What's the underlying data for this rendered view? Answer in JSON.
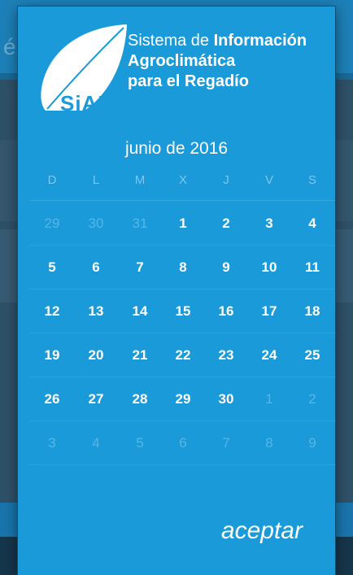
{
  "background": {
    "partial_text": "é"
  },
  "header": {
    "logo_text": "SiAR",
    "title_line1_regular": "Sistema de ",
    "title_line1_bold": "Información",
    "title_line2": "Agroclimática",
    "title_line3": "para el Regadío"
  },
  "calendar": {
    "month_label": "junio de 2016",
    "weekdays": [
      "D",
      "L",
      "M",
      "X",
      "J",
      "V",
      "S"
    ],
    "weeks": [
      [
        {
          "d": "29",
          "dim": true
        },
        {
          "d": "30",
          "dim": true
        },
        {
          "d": "31",
          "dim": true
        },
        {
          "d": "1",
          "dim": false
        },
        {
          "d": "2",
          "dim": false
        },
        {
          "d": "3",
          "dim": false
        },
        {
          "d": "4",
          "dim": false
        }
      ],
      [
        {
          "d": "5",
          "dim": false
        },
        {
          "d": "6",
          "dim": false
        },
        {
          "d": "7",
          "dim": false
        },
        {
          "d": "8",
          "dim": false
        },
        {
          "d": "9",
          "dim": false
        },
        {
          "d": "10",
          "dim": false
        },
        {
          "d": "11",
          "dim": false
        }
      ],
      [
        {
          "d": "12",
          "dim": false
        },
        {
          "d": "13",
          "dim": false
        },
        {
          "d": "14",
          "dim": false
        },
        {
          "d": "15",
          "dim": false
        },
        {
          "d": "16",
          "dim": false
        },
        {
          "d": "17",
          "dim": false
        },
        {
          "d": "18",
          "dim": false
        }
      ],
      [
        {
          "d": "19",
          "dim": false
        },
        {
          "d": "20",
          "dim": false
        },
        {
          "d": "21",
          "dim": false
        },
        {
          "d": "22",
          "dim": false
        },
        {
          "d": "23",
          "dim": false
        },
        {
          "d": "24",
          "dim": false
        },
        {
          "d": "25",
          "dim": false
        }
      ],
      [
        {
          "d": "26",
          "dim": false
        },
        {
          "d": "27",
          "dim": false
        },
        {
          "d": "28",
          "dim": false
        },
        {
          "d": "29",
          "dim": false
        },
        {
          "d": "30",
          "dim": false
        },
        {
          "d": "1",
          "dim": true
        },
        {
          "d": "2",
          "dim": true
        }
      ],
      [
        {
          "d": "3",
          "dim": true
        },
        {
          "d": "4",
          "dim": true
        },
        {
          "d": "5",
          "dim": true
        },
        {
          "d": "6",
          "dim": true
        },
        {
          "d": "7",
          "dim": true
        },
        {
          "d": "8",
          "dim": true
        },
        {
          "d": "9",
          "dim": true
        }
      ]
    ]
  },
  "footer": {
    "accept_label": "aceptar"
  },
  "colors": {
    "dialog_bg": "#1a9ad9",
    "text": "#ffffff",
    "dim_text": "#58b6e4",
    "weekday_text": "#7fc6ec"
  }
}
